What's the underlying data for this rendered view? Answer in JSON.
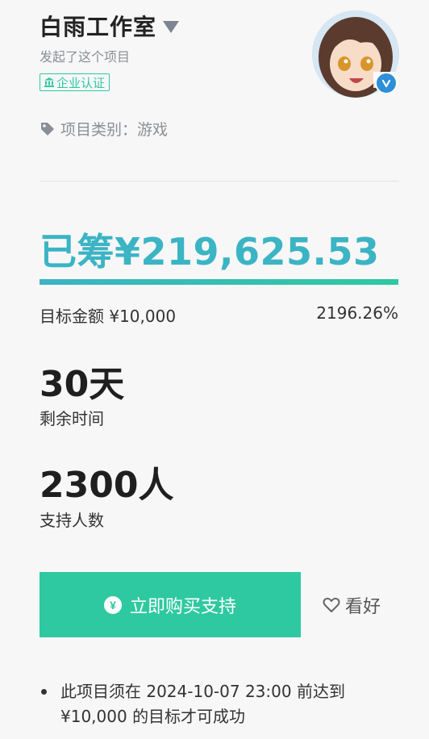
{
  "creator": {
    "name": "白雨工作室",
    "subtitle": "发起了这个项目",
    "badge": "企业认证",
    "category": "项目类别：游戏"
  },
  "funding": {
    "raised": "已筹¥219,625.53",
    "goal": "目标金额 ¥10,000",
    "percent": "2196.26%",
    "progress_fraction": 1.0
  },
  "stats": {
    "days_value": "30天",
    "days_label": "剩余时间",
    "backers_value": "2300人",
    "backers_label": "支持人数"
  },
  "actions": {
    "buy_icon": "¥",
    "buy_label": "立即购买支持",
    "fav_label": "看好"
  },
  "notice": {
    "line1": "此项目须在 2024-10-07 23:00 前达到",
    "line2": "¥10,000 的目标才可成功"
  },
  "colors": {
    "accent_teal": "#3bb4c4",
    "accent_green": "#2ec9a0",
    "verified_blue": "#2f8fd8"
  },
  "icons": [
    "caret-down-icon",
    "bank-icon",
    "tag-icon",
    "verified-check-icon",
    "yen-circle-icon",
    "heart-outline-icon"
  ]
}
